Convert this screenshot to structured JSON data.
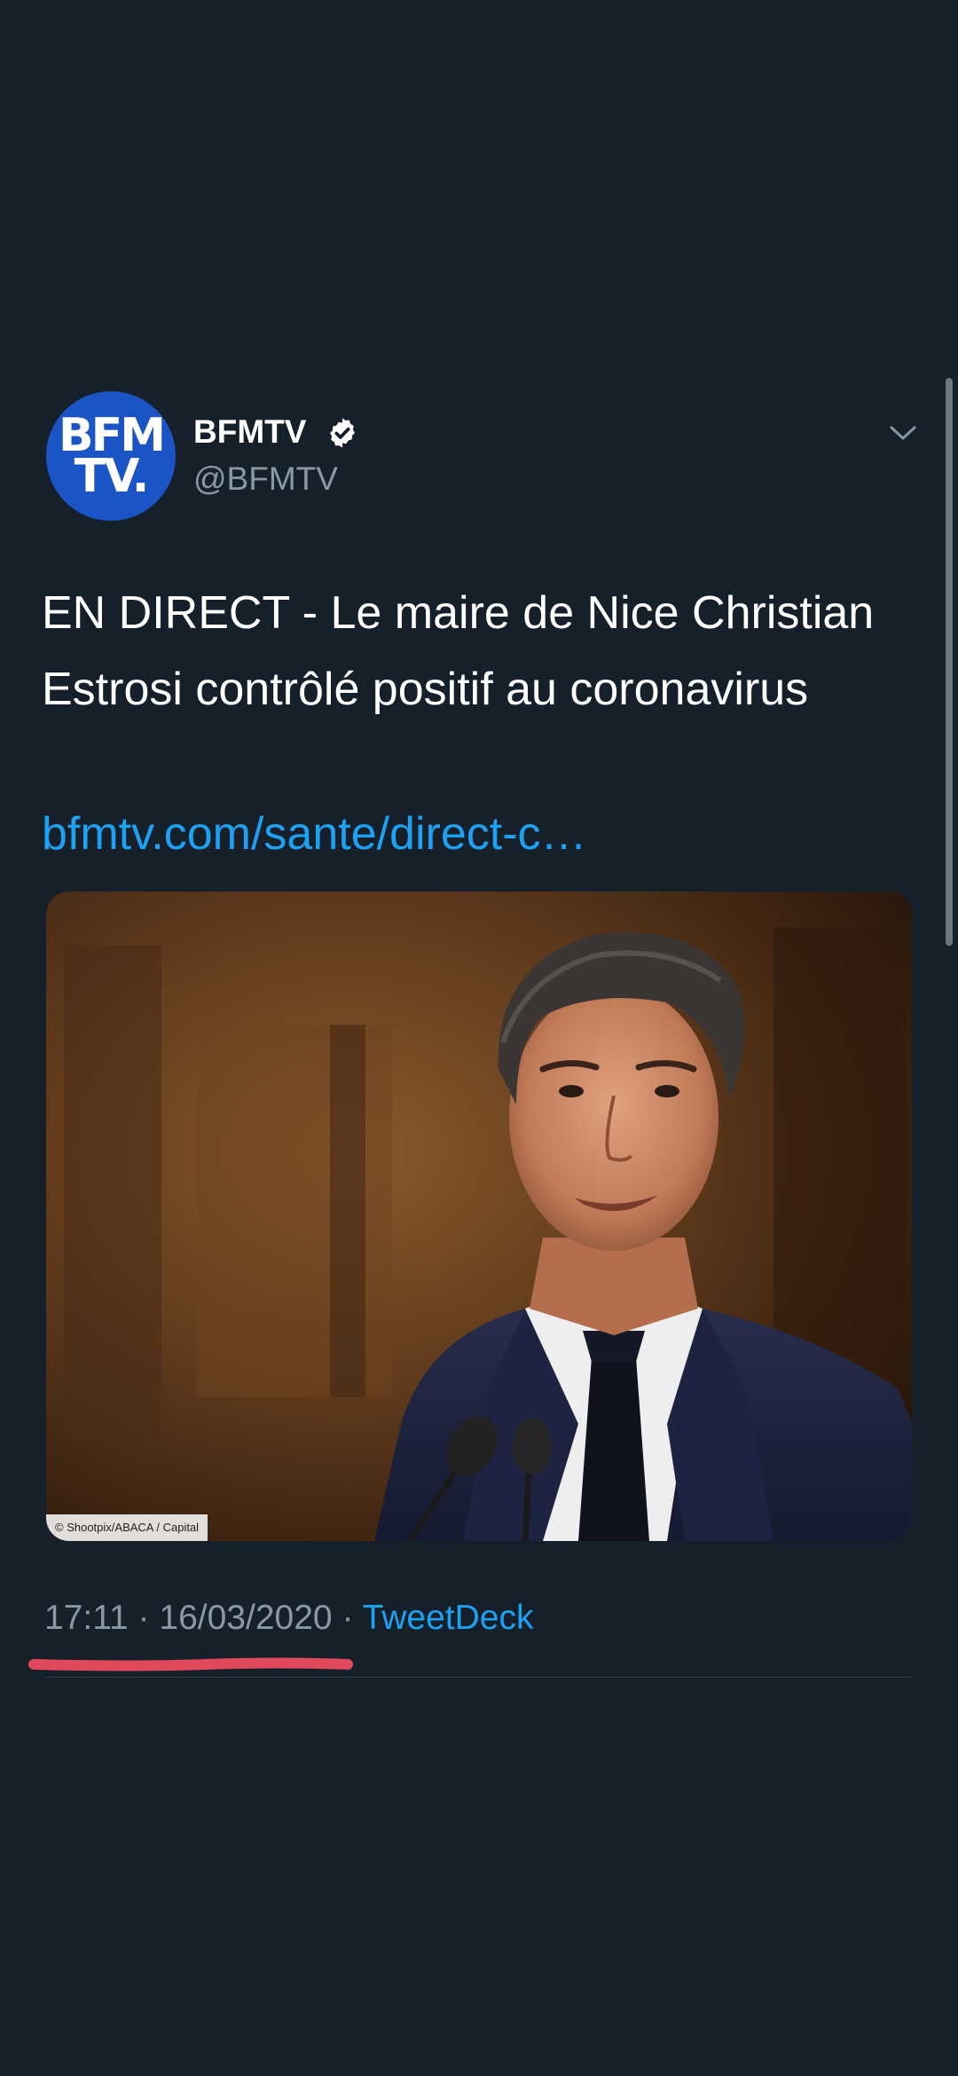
{
  "tweet": {
    "author": {
      "avatar_logo_line1": "BFM",
      "avatar_logo_line2": "TV.",
      "display_name": "BFMTV",
      "handle": "@BFMTV",
      "verified": true,
      "verified_icon": "verified-badge-icon"
    },
    "menu_icon": "chevron-down-icon",
    "text": "EN DIRECT - Le maire de Nice Christian Estrosi contrôlé positif au coronavirus",
    "link": "bfmtv.com/sante/direct-c…",
    "media": {
      "photo_credit": "© Shootpix/ABACA / Capital"
    },
    "meta": {
      "time": "17:11",
      "separator": "·",
      "date": "16/03/2020",
      "source": "TweetDeck"
    }
  },
  "colors": {
    "background": "#15202b",
    "link": "#1da1f2",
    "secondary_text": "#8899a6",
    "avatar_brand": "#1b54c4",
    "annotation_underline": "#e0485b"
  }
}
